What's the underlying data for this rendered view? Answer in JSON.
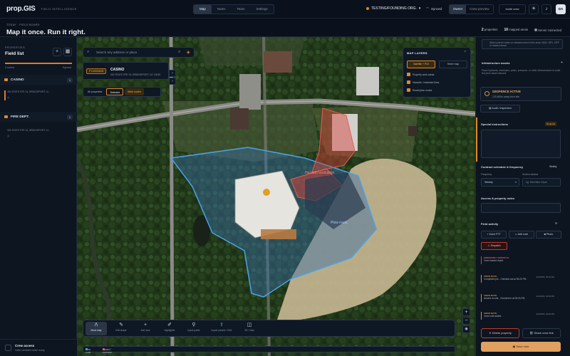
{
  "app": {
    "logo": "prop.GIS",
    "subtitle": "FIELD INTELLIGENCE"
  },
  "nav": {
    "tabs": [
      "Map",
      "Notes",
      "Team",
      "Settings"
    ],
    "active": "Map"
  },
  "org": {
    "name": "TESTING/FOUNDING ORG.",
    "status": "Synced"
  },
  "roles": {
    "owner": "Owner",
    "crew": "Crew preview"
  },
  "header_actions": {
    "invite": "Invite crew",
    "avatar": "DA"
  },
  "page": {
    "crumb": "TODAY · FIELD BOARD",
    "title": "Map it once. Run it right."
  },
  "stats": {
    "properties_count": "2",
    "properties_label": "properties",
    "areas_count": "10",
    "areas_label": "mapped areas",
    "server": "Server connected"
  },
  "sidebar": {
    "head": "PROPERTIES",
    "title": "Field list",
    "meta_left": "2 sorted",
    "meta_right": "Synced",
    "groups": [
      {
        "name": "CASINO",
        "count": "1",
        "address": "400 STATE RTE 31, BRIDGEPORT, N..."
      },
      {
        "name": "FIRE DEPT.",
        "count": "1",
        "address": "400 STATE RTE 31, BRIDGEPORT, N..."
      }
    ],
    "crew_title": "Crew access",
    "crew_sub": "Invite members when ready"
  },
  "map": {
    "search_placeholder": "Search any address or place",
    "card_badge": "FY-00000678",
    "card_name": "CASINO",
    "card_address": "400 STATE RTE 31, BRIDGEPORT, NY 13030",
    "buttons": [
      "All properties",
      "Selected",
      "Work routes"
    ],
    "labels": {
      "hazard": "Hazard / exclusion",
      "plow": "Plow route"
    }
  },
  "layers": {
    "title": "MAP LAYERS",
    "seg": [
      "Satellite + POI",
      "Street map"
    ],
    "items": [
      "Property work areas",
      "Hazards / restricted lines",
      "Route/plow routes"
    ]
  },
  "toolbar": {
    "tools": [
      "Move map",
      "Edit shape",
      "Add area",
      "Highlighter",
      "Quick points",
      "Import parcels / KML",
      "3D / Hide"
    ],
    "active": "Move map"
  },
  "legend": {
    "items": [
      "Plow route",
      "Hazard / exclusion"
    ]
  },
  "right": {
    "top_hint": "Attach parcel notes or infrastructure to this area; MAD, MFL, NFF or hazard areas",
    "infra_title": "Infrastructure assets",
    "infra_hint": "Place hydrants, manholes, poles, pressure, or other infrastructure to build the plow asset network",
    "geofence": "GEOFENCE ACTIVE",
    "geofence_sub": "125-650m away from site",
    "audit": "Audit / Inspection",
    "special_title": "Special instructions",
    "special_badge": "Required",
    "contract_title": "Contract schedule & frequency",
    "contract_badge": "Weekly",
    "freq_label": "Frequency",
    "freq_value": "Weekly",
    "window_label": "Service window",
    "window_placeholder": "eg. Wed 8am-10pm",
    "access_title": "Access & property notes",
    "activity_title": "Field activity",
    "act_buttons": [
      "Voice PTT",
      "Add note",
      "Photo"
    ],
    "dispatch": "Dispatch",
    "notes": [
      {
        "tag": "EMERGENCY DISPATCH",
        "text": "Crew hazard report",
        "date": ""
      },
      {
        "tag": "CREW NOTE",
        "text": "Completed job - Checked out at 05:22 PM",
        "date": "4/14/2026, 05:22 PM"
      },
      {
        "tag": "CREW NOTE",
        "text": "Arrived on site - Checked in at 03:20 PM",
        "date": "4/14/2026, 03:20 PM"
      },
      {
        "tag": "CREW NOTE",
        "text": "Crew note added",
        "date": "4/14/2026, 03:00 PM"
      }
    ],
    "delete": "Delete property",
    "share": "Share crew link",
    "save": "Save note"
  },
  "colors": {
    "accent": "#e08a2a",
    "hazard": "#d9403a",
    "plow": "#3b8fd6",
    "bg": "#0b1320"
  }
}
